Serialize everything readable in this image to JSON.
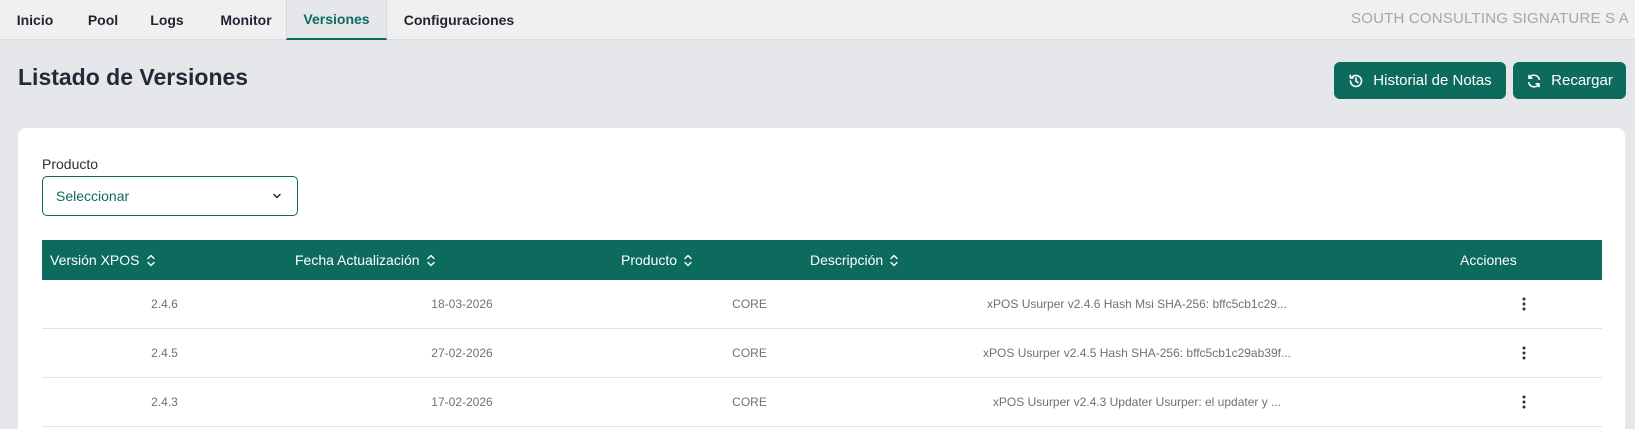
{
  "nav": {
    "tabs": [
      {
        "label": "Inicio"
      },
      {
        "label": "Pool"
      },
      {
        "label": "Logs"
      },
      {
        "label": "Monitor"
      },
      {
        "label": "Versiones"
      },
      {
        "label": "Configuraciones"
      }
    ],
    "active_tab": "Versiones",
    "company": "SOUTH CONSULTING SIGNATURE S A"
  },
  "header": {
    "title": "Listado de Versiones",
    "history_button": "Historial de Notas",
    "reload_button": "Recargar"
  },
  "filter": {
    "label": "Producto",
    "value": "Seleccionar"
  },
  "table": {
    "columns": [
      {
        "label": "Versión XPOS"
      },
      {
        "label": "Fecha Actualización"
      },
      {
        "label": "Producto"
      },
      {
        "label": "Descripción"
      },
      {
        "label": "Acciones"
      }
    ],
    "rows": [
      {
        "version": "2.4.6",
        "date": "18-03-2026",
        "product": "CORE",
        "description": "xPOS Usurper v2.4.6 Hash Msi SHA-256: bffc5cb1c29..."
      },
      {
        "version": "2.4.5",
        "date": "27-02-2026",
        "product": "CORE",
        "description": "xPOS Usurper v2.4.5 Hash SHA-256: bffc5cb1c29ab39f..."
      },
      {
        "version": "2.4.3",
        "date": "17-02-2026",
        "product": "CORE",
        "description": "xPOS Usurper v2.4.3 Updater Usurper: el updater y ..."
      }
    ]
  },
  "colors": {
    "accent": "#0d6b5e",
    "background": "#e6e7ea",
    "card": "#ffffff"
  },
  "icons": {
    "history": "history-icon",
    "reload": "refresh-icon",
    "dropdown": "chevron-down-icon",
    "sort": "sort-icon",
    "actions": "kebab-menu-icon"
  }
}
